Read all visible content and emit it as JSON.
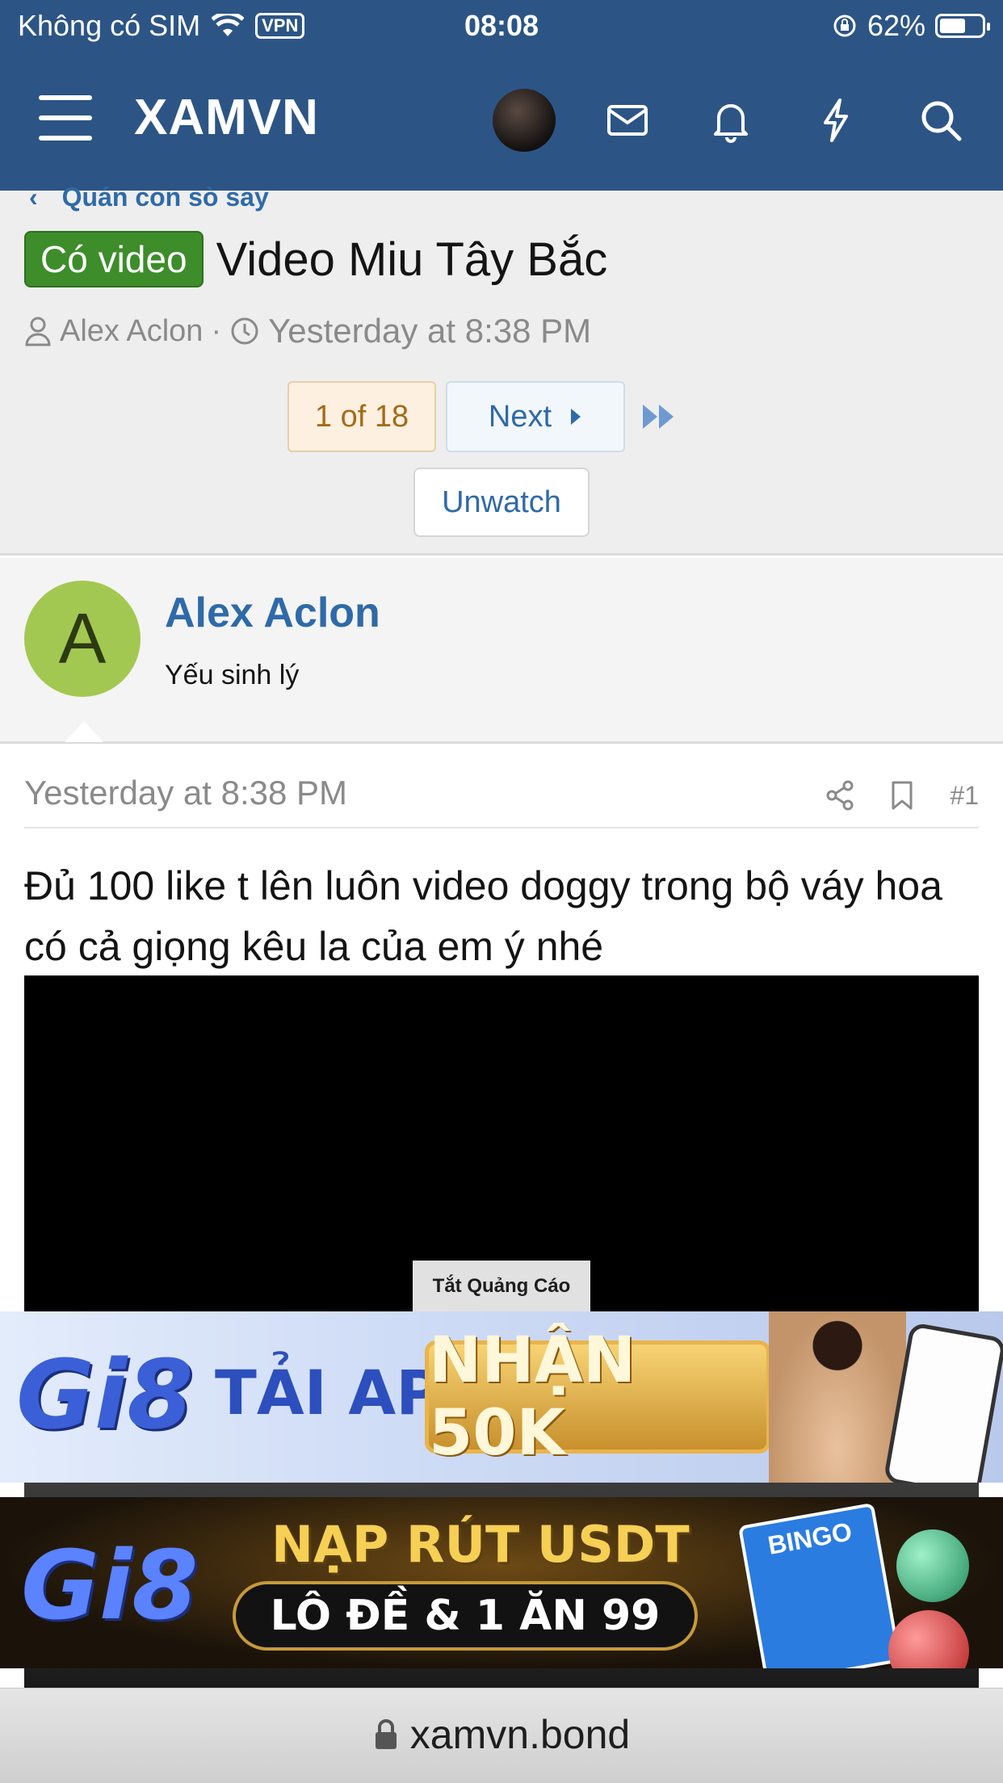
{
  "status_bar": {
    "carrier": "Không có SIM",
    "vpn": "VPN",
    "time": "08:08",
    "battery": "62%",
    "battery_level": 0.62
  },
  "header": {
    "logo": "XAMVN"
  },
  "breadcrumb": {
    "label": "Quán con sò say"
  },
  "thread": {
    "prefix": "Có video",
    "title": "Video Miu Tây Bắc",
    "author": "Alex Aclon",
    "separator": "·",
    "timestamp": "Yesterday at 8:38 PM"
  },
  "pagination": {
    "current": "1 of 18",
    "next": "Next"
  },
  "unwatch_label": "Unwatch",
  "post": {
    "avatar_letter": "A",
    "username": "Alex Aclon",
    "user_title": "Yếu sinh lý",
    "date": "Yesterday at 8:38 PM",
    "number": "#1",
    "text": "Đủ 100 like t lên luôn video doggy trong bộ váy hoa có cả giọng kêu la của em ý nhé"
  },
  "ads": {
    "close_label": "Tắt Quảng Cáo",
    "ad1": {
      "brand": "Gi8",
      "tagline": "TẢI APP",
      "offer": "NHẬN 50K"
    },
    "ad2": {
      "brand": "Gi8",
      "headline": "NẠP RÚT USDT",
      "sub": "LÔ ĐỀ & 1 ĂN 99",
      "badge": "BINGO"
    }
  },
  "url_bar": {
    "domain": "xamvn.bond"
  },
  "colors": {
    "header": "#2c5585",
    "link": "#2f6aa8",
    "prefix_badge": "#3d8d2a",
    "avatar": "#a3c851"
  }
}
